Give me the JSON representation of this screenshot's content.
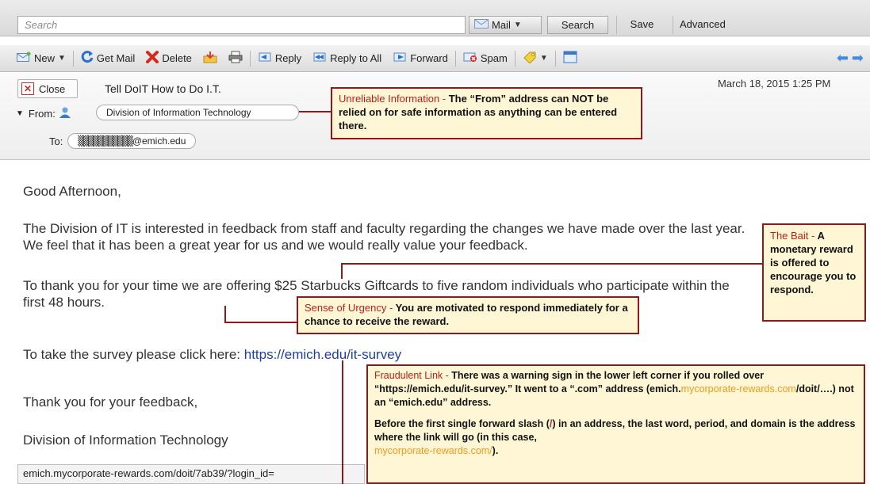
{
  "search_bar": {
    "placeholder": "Search",
    "scope": "Mail",
    "search_label": "Search",
    "save_label": "Save",
    "advanced_label": "Advanced"
  },
  "toolbar": {
    "new_label": "New",
    "get_mail_label": "Get Mail",
    "delete_label": "Delete",
    "reply_label": "Reply",
    "reply_all_label": "Reply to All",
    "forward_label": "Forward",
    "spam_label": "Spam"
  },
  "message": {
    "close_label": "Close",
    "subject": "Tell DoIT How to Do I.T.",
    "date": "March 18, 2015  1:25 PM",
    "from_label": "From:",
    "from_value": "Division of Information Technology",
    "to_label": "To:",
    "to_mask": "▒▒▒▒▒▒▒▒▒▒▒",
    "to_domain": "@emich.edu"
  },
  "body": {
    "greeting": "Good Afternoon,",
    "p1": "The Division of IT is interested in feedback from staff and faculty regarding the changes we have made over the last year. We feel that it has been a great year for us and we would really value your feedback.",
    "p2": "To thank you for your time we are offering $25 Starbucks Giftcards to five random individuals who participate within the first 48 hours.",
    "p3_prefix": "To take the survey please click here: ",
    "p3_link": "https://emich.edu/it-survey",
    "thanks": "Thank you for your feedback,",
    "signature": "Division of Information Technology"
  },
  "status_bar": "emich.mycorporate-rewards.com/doit/7ab39/?login_id=",
  "annotations": {
    "unreliable": {
      "title": "Unreliable Information -",
      "text": " The “From” address can NOT be relied on for safe information as anything can be entered there."
    },
    "bait": {
      "title": "The Bait -",
      "text": " A monetary reward is offered to encourage you to respond."
    },
    "urgency": {
      "title": "Sense of Urgency -",
      "text": " You are motivated to respond immediately for a chance to receive the reward."
    },
    "fraud": {
      "title": "Fraudulent Link -",
      "text1": " There was a warning sign in the lower left corner if you rolled over “https://emich.edu/it-survey.” It went to a “.com” address (emich.",
      "text1_orange": "mycorporate-rewards.com",
      "text1_end": "/doit/….) not an “emich.edu” address.",
      "text2a": "Before the first single forward slash (",
      "text2_slash": "/",
      "text2b": ") in an address, the last word, period, and domain is the address where the link will go (in this case,",
      "text2_orange": "mycorporate-rewards.com/",
      "text2_end": ")."
    }
  },
  "colors": {
    "annotation_border": "#8b1a1a",
    "annotation_bg": "#fff6d6",
    "annotation_title": "#b8211a",
    "highlight_orange": "#f09a1a",
    "link_blue": "#1f3fa6"
  }
}
